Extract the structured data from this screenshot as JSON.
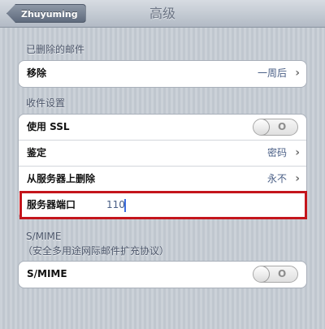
{
  "navbar": {
    "back_label": "Zhuyuming",
    "title": "高级"
  },
  "deleted_mail": {
    "header": "已删除的邮件",
    "remove_label": "移除",
    "remove_value": "一周后"
  },
  "incoming": {
    "header": "收件设置",
    "ssl_label": "使用 SSL",
    "ssl_state": "O",
    "auth_label": "鉴定",
    "auth_value": "密码",
    "delete_label": "从服务器上删除",
    "delete_value": "永不",
    "port_label": "服务器端口",
    "port_value": "110"
  },
  "smime": {
    "header": "S/MIME",
    "subheader": "（安全多用途网际邮件扩充协议）",
    "label": "S/MIME",
    "state": "O"
  },
  "icons": {
    "chevron": "chevron-right-icon"
  },
  "colors": {
    "highlight": "#c4151c",
    "value_text": "#4a5f86",
    "caret": "#3d6ee0"
  }
}
